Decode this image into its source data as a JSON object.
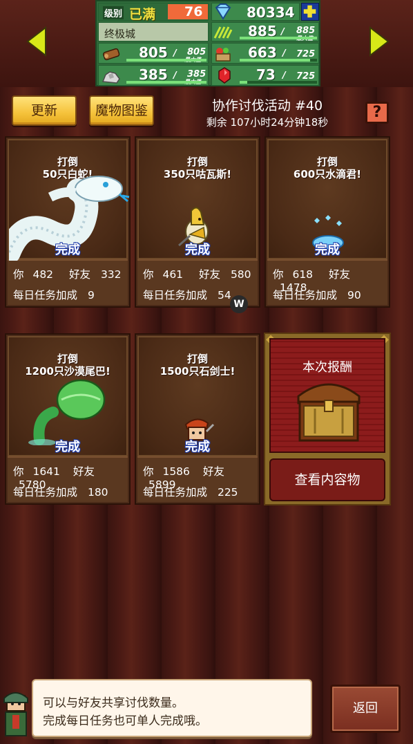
{
  "stats": {
    "level_label": "级别",
    "level_status": "已满",
    "level_value": "76",
    "gems": "80334",
    "city_name": "终极城",
    "grass": {
      "value": "885",
      "max": "885",
      "max_label": "最大值"
    },
    "wood": {
      "value": "805",
      "max": "805",
      "max_label": "最大值"
    },
    "food": {
      "value": "663",
      "max": "725"
    },
    "stone": {
      "value": "385",
      "max": "385",
      "max_label": "最大值"
    },
    "ruby": {
      "value": "73",
      "max": "725"
    },
    "separator": "/"
  },
  "header": {
    "update_label": "更新",
    "monster_book_label": "魔物图鉴",
    "event_title": "协作讨伐活动 #40",
    "remaining": "剩余 107小时24分钟18秒",
    "help_label": "?"
  },
  "labels": {
    "you": "你",
    "friends": "好友",
    "daily_bonus": "每日任务加成",
    "done": "完成"
  },
  "cards": [
    {
      "goal_line1": "打倒",
      "goal_line2": "50只白蛇!",
      "you": "482",
      "friends": "332",
      "daily": "9",
      "status": "完成",
      "monster": "white-serpent"
    },
    {
      "goal_line1": "打倒",
      "goal_line2": "350只咕瓦斯!",
      "you": "461",
      "friends": "580",
      "daily": "54",
      "status": "完成",
      "monster": "gwas-bird"
    },
    {
      "goal_line1": "打倒",
      "goal_line2": "600只水滴君!",
      "you": "618",
      "friends": "1478",
      "daily": "90",
      "status": "完成",
      "monster": "water-drop"
    },
    {
      "goal_line1": "打倒",
      "goal_line2": "1200只沙漠尾巴!",
      "you": "1641",
      "friends": "5780",
      "daily": "180",
      "status": "完成",
      "monster": "desert-tail"
    },
    {
      "goal_line1": "打倒",
      "goal_line2": "1500只石剑士!",
      "you": "1586",
      "friends": "5899",
      "daily": "225",
      "status": "完成",
      "monster": "stone-swordsman"
    }
  ],
  "reward": {
    "title": "本次报酬",
    "view_button": "查看内容物"
  },
  "watermark": "W",
  "tip": {
    "line1": "可以与好友共享讨伐数量。",
    "line2": "完成每日任务也可单人完成哦。"
  },
  "back_button": "返回",
  "colors": {
    "stats_green": "#3d8a4c",
    "button_yellow": "#f5c23a",
    "reward_red": "#8c1c1c",
    "done_blue": "#1c3aa8"
  }
}
